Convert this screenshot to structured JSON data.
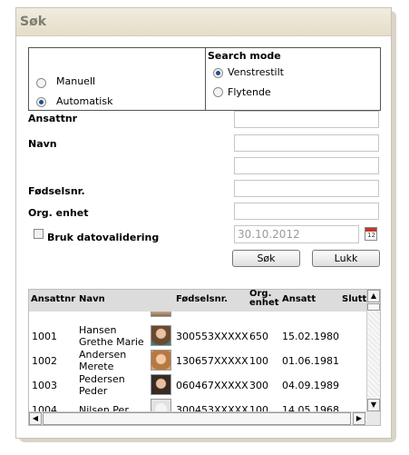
{
  "panel": {
    "title": "Søk"
  },
  "entry_mode": {
    "options": [
      {
        "label": "Manuell",
        "selected": false
      },
      {
        "label": "Automatisk",
        "selected": true
      }
    ]
  },
  "search_mode": {
    "title": "Search mode",
    "options": [
      {
        "label": "Venstrestilt",
        "selected": true
      },
      {
        "label": "Flytende",
        "selected": false
      }
    ]
  },
  "form": {
    "ansattnr_label": "Ansattnr",
    "ansattnr_value": "",
    "navn_label": "Navn",
    "navn_value_1": "",
    "navn_value_2": "",
    "fodselsnr_label": "Fødselsnr.",
    "fodselsnr_value": "",
    "org_enhet_label": "Org. enhet",
    "org_enhet_value": "",
    "datovalidering_label": "Bruk datovalidering",
    "datovalidering_checked": false,
    "date_placeholder": "30.10.2012",
    "calendar_day": "12"
  },
  "buttons": {
    "search": "Søk",
    "close": "Lukk"
  },
  "results": {
    "columns": [
      "Ansattnr",
      "Navn",
      "",
      "Fødselsnr.",
      "Org. enhet",
      "Ansatt",
      "Slutt"
    ],
    "rows": [
      {
        "ansattnr": "1001",
        "navn_1": "Hansen",
        "navn_2": "Grethe Marie",
        "fodselsnr": "300553XXXXX",
        "org": "650",
        "ansatt": "15.02.1980"
      },
      {
        "ansattnr": "1002",
        "navn_1": "Andersen",
        "navn_2": "Merete",
        "fodselsnr": "130657XXXXX",
        "org": "100",
        "ansatt": "01.06.1981"
      },
      {
        "ansattnr": "1003",
        "navn_1": "Pedersen",
        "navn_2": "Peder",
        "fodselsnr": "060467XXXXX",
        "org": "300",
        "ansatt": "04.09.1989"
      },
      {
        "ansattnr": "1004",
        "navn_1": "Nilsen Per",
        "navn_2": "",
        "fodselsnr": "300453XXXXX",
        "org": "100",
        "ansatt": "14.05.1968"
      }
    ]
  },
  "colors": {
    "title_bar": "#e8e2d0",
    "title_text": "#7f7d73",
    "radio_dot": "#1f4f8f",
    "grid_header": "#dcdcdc"
  }
}
